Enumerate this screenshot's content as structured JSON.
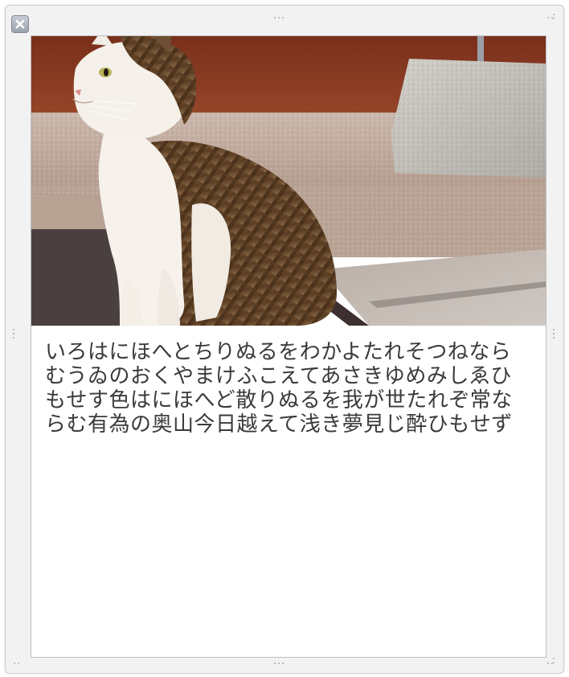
{
  "window": {
    "title": ""
  },
  "photo": {
    "subject": "cat",
    "colors": {
      "wall": "#8a3a22",
      "step": "#c9b7ab",
      "pavement": "#b8b0a9",
      "block": "#c5c3bd",
      "cat_white": "#f4efe8",
      "cat_brown": "#6b4a2e"
    }
  },
  "caption": {
    "text": "いろはにほへとちりぬるをわかよたれそつねならむうゐのおくやまけふこえてあさきゆめみしゑひもせす色はにほへど散りぬるを我が世たれぞ常ならむ有為の奥山今日越えて浅き夢見じ酔ひもせず"
  }
}
